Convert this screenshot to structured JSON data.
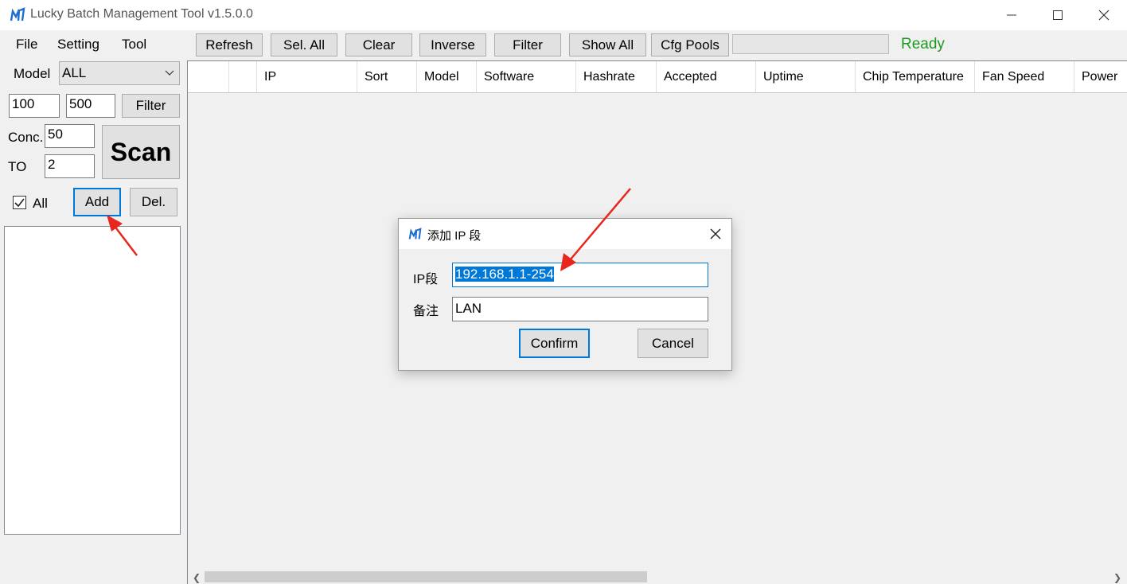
{
  "window": {
    "title": "Lucky Batch Management Tool v1.5.0.0",
    "controls": [
      "minimize",
      "maximize",
      "close"
    ]
  },
  "menu": [
    "File",
    "Setting",
    "Tool"
  ],
  "toolbar": {
    "buttons": [
      "Refresh",
      "Sel. All",
      "Clear",
      "Inverse",
      "Filter",
      "Show All",
      "Cfg Pools"
    ],
    "status": "Ready",
    "status_color": "#1e9a1e"
  },
  "left_panel": {
    "model_label": "Model",
    "model_value": "ALL",
    "range_min": "100",
    "range_max": "500",
    "filter_label": "Filter",
    "conc_label": "Conc.",
    "conc_value": "50",
    "to_label": "TO",
    "to_value": "2",
    "scan_label": "Scan",
    "all_label": "All",
    "all_checked": true,
    "add_label": "Add",
    "del_label": "Del."
  },
  "table": {
    "columns": [
      "",
      "",
      "IP",
      "Sort",
      "Model",
      "Software",
      "Hashrate",
      "Accepted",
      "Uptime",
      "Chip Temperature",
      "Fan Speed",
      "Power"
    ]
  },
  "dialog": {
    "title": "添加 IP 段",
    "ip_label": "IP段",
    "ip_value": "192.168.1.1-254",
    "note_label": "备注",
    "note_value": "LAN",
    "confirm_label": "Confirm",
    "cancel_label": "Cancel"
  },
  "colors": {
    "accent": "#0078d7",
    "annotation": "#e8261b"
  }
}
